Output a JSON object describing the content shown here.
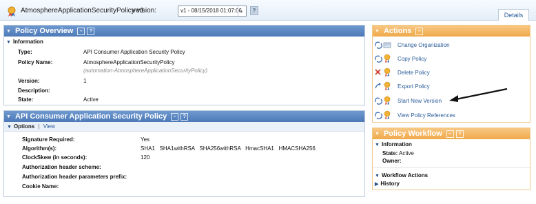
{
  "header": {
    "policy_title": "AtmosphereApplicationSecurityPolicy v1",
    "version_label": "version:",
    "version_selected": "v1 - 08/15/2018 01:07:06",
    "help_label": "?",
    "details_tab": "Details"
  },
  "policy_overview": {
    "title": "Policy Overview",
    "section": "Information",
    "rows": [
      {
        "label": "Type:",
        "value": "API Consumer Application Security Policy"
      },
      {
        "label": "Policy Name:",
        "value": "AtmosphereApplicationSecurityPolicy"
      },
      {
        "label": "",
        "value": "(automation-AtmosphereApplicationSecurityPolicy)"
      },
      {
        "label": "Version:",
        "value": "1"
      },
      {
        "label": "Description:",
        "value": ""
      },
      {
        "label": "State:",
        "value": "Active"
      }
    ]
  },
  "consumer_policy": {
    "title": "API Consumer Application Security Policy",
    "options_label": "Options",
    "separator": "|",
    "view_label": "View",
    "rows": [
      {
        "label": "Signature Required:",
        "value": "Yes"
      },
      {
        "label": "Algorithm(s):",
        "value": "SHA1   SHA1withRSA   SHA256withRSA   HmacSHA1   HMACSHA256"
      },
      {
        "label": "ClockSkew (in seconds):",
        "value": "120"
      },
      {
        "label": "Authorization header scheme:",
        "value": ""
      },
      {
        "label": "Authorization header parameters prefix:",
        "value": ""
      },
      {
        "label": "Cookie Name:",
        "value": ""
      }
    ]
  },
  "actions": {
    "title": "Actions",
    "items": [
      {
        "label": "Change Organization",
        "icon": "change-organization-icon"
      },
      {
        "label": "Copy Policy",
        "icon": "copy-policy-icon"
      },
      {
        "label": "Delete Policy",
        "icon": "delete-policy-icon"
      },
      {
        "label": "Export Policy",
        "icon": "export-policy-icon"
      },
      {
        "label": "Start New Version",
        "icon": "start-new-version-icon"
      },
      {
        "label": "View Policy References",
        "icon": "view-policy-references-icon"
      }
    ]
  },
  "policy_workflow": {
    "title": "Policy Workflow",
    "info_label": "Information",
    "state_label": "State:",
    "state_value": "Active",
    "owner_label": "Owner:",
    "workflow_actions_label": "Workflow Actions",
    "history_label": "History"
  },
  "colors": {
    "blue_header": "#4d7ab8",
    "orange_header": "#f0a94a",
    "link": "#2a5c9a"
  }
}
